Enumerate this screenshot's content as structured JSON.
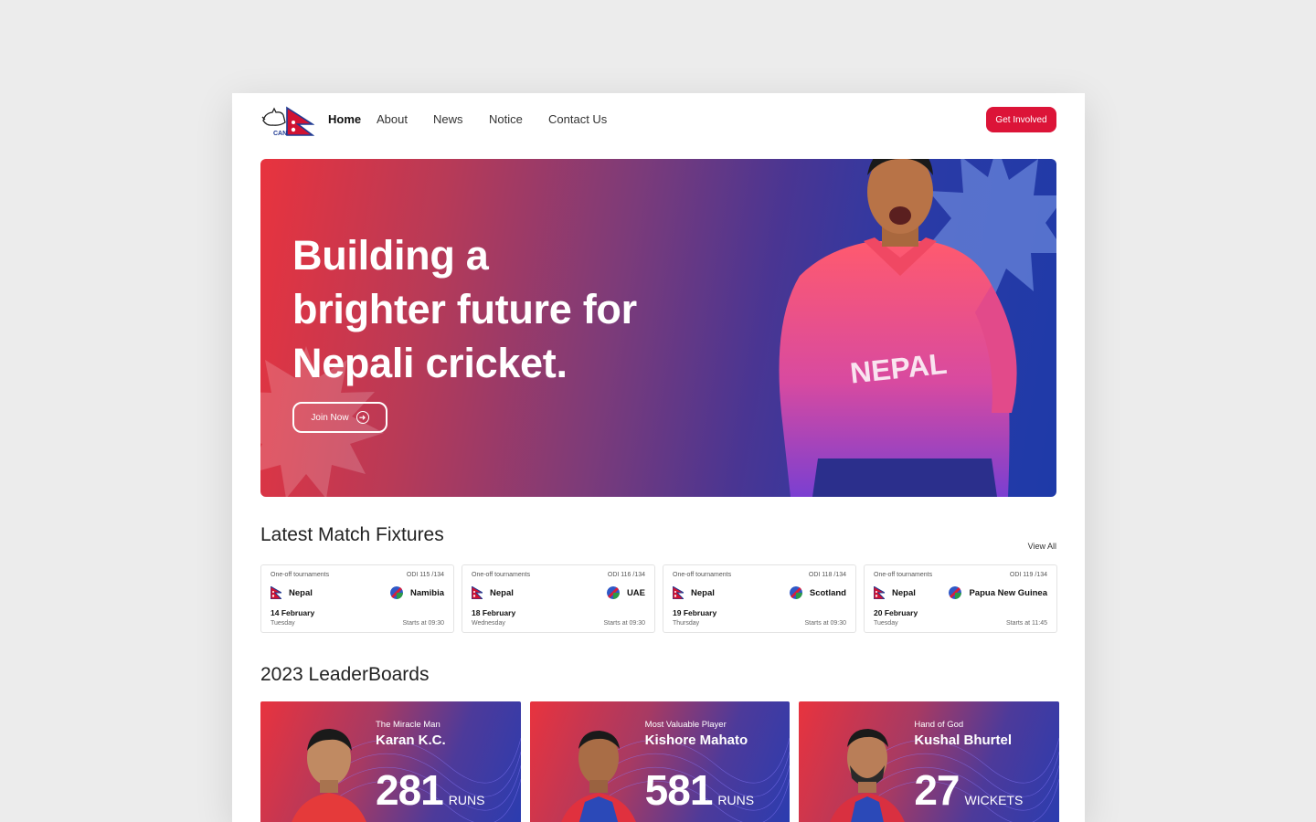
{
  "nav": {
    "logo_text": "CAN",
    "links": [
      "Home",
      "About",
      "News",
      "Notice",
      "Contact Us"
    ],
    "cta": "Get Involved"
  },
  "hero": {
    "title_lines": [
      "Building a",
      "brighter future for",
      "Nepali cricket."
    ],
    "button": "Join Now",
    "jersey_text": "NEPAL"
  },
  "fixtures": {
    "title": "Latest Match Fixtures",
    "view_all": "View All",
    "items": [
      {
        "tournament": "One-off tournaments",
        "code": "ODI 115 /134",
        "home": "Nepal",
        "away": "Namibia",
        "date": "14 February",
        "day": "Tuesday",
        "time": "Starts at 09:30",
        "away_flag": "namibia-flag-icon"
      },
      {
        "tournament": "One-off tournaments",
        "code": "ODI 116 /134",
        "home": "Nepal",
        "away": "UAE",
        "date": "18 February",
        "day": "Wednesday",
        "time": "Starts at 09:30",
        "away_flag": "namibia-flag-icon"
      },
      {
        "tournament": "One-off tournaments",
        "code": "ODI 118 /134",
        "home": "Nepal",
        "away": "Scotland",
        "date": "19 February",
        "day": "Thursday",
        "time": "Starts at 09:30",
        "away_flag": "namibia-flag-icon"
      },
      {
        "tournament": "One-off tournaments",
        "code": "ODI 119 /134",
        "home": "Nepal",
        "away": "Papua New Guinea",
        "date": "20 February",
        "day": "Tuesday",
        "time": "Starts at 11:45",
        "away_flag": "namibia-flag-icon"
      }
    ]
  },
  "leaderboards": {
    "title": "2023 LeaderBoards",
    "cards": [
      {
        "subtitle": "The Miracle Man",
        "name": "Karan K.C.",
        "value": "281",
        "unit": "RUNS"
      },
      {
        "subtitle": "Most Valuable Player",
        "name": "Kishore Mahato",
        "value": "581",
        "unit": "RUNS"
      },
      {
        "subtitle": "Hand of God",
        "name": "Kushal Bhurtel",
        "value": "27",
        "unit": "WICKETS"
      }
    ]
  },
  "colors": {
    "accent": "#dc1438",
    "hero_start": "#e8333e",
    "hero_end": "#1e3aa8"
  }
}
